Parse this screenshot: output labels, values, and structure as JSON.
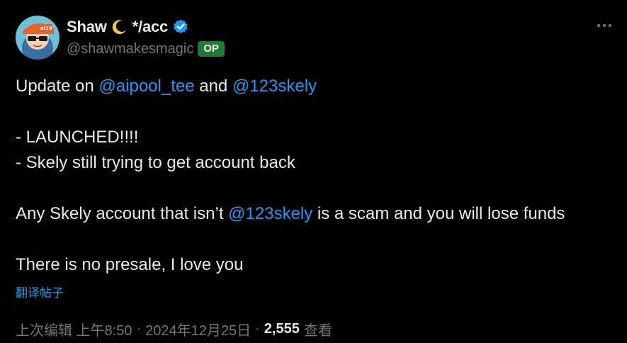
{
  "author": {
    "display_name": "Shaw",
    "name_suffix": "*/acc",
    "handle": "@shawmakesmagic",
    "badge": "OP",
    "avatar_cap_text": "ai16"
  },
  "tweet": {
    "line1_prefix": "Update on ",
    "mention1": "@aipool_tee",
    "line1_mid": " and ",
    "mention2": "@123skely",
    "line2": "- LAUNCHED!!!!",
    "line3": "- Skely still trying to get account back",
    "line4_prefix": "Any Skely account that isn’t ",
    "mention3": "@123skely",
    "line4_suffix": " is a scam and you will lose funds",
    "line5": "There is no presale, I love you"
  },
  "translate_label": "翻译帖子",
  "meta": {
    "edited_label": "上次编辑 上午8:50",
    "date": "2024年12月25日",
    "views_count": "2,555",
    "views_label": "查看",
    "separator": "·"
  },
  "colors": {
    "background": "#000000",
    "text": "#e7e9ea",
    "muted": "#71767b",
    "link": "#1d9bf0",
    "op_badge": "#1f7a34"
  },
  "icons": {
    "moon": "crescent-moon-icon",
    "verified": "verified-badge-icon",
    "more": "more-dots-icon"
  }
}
